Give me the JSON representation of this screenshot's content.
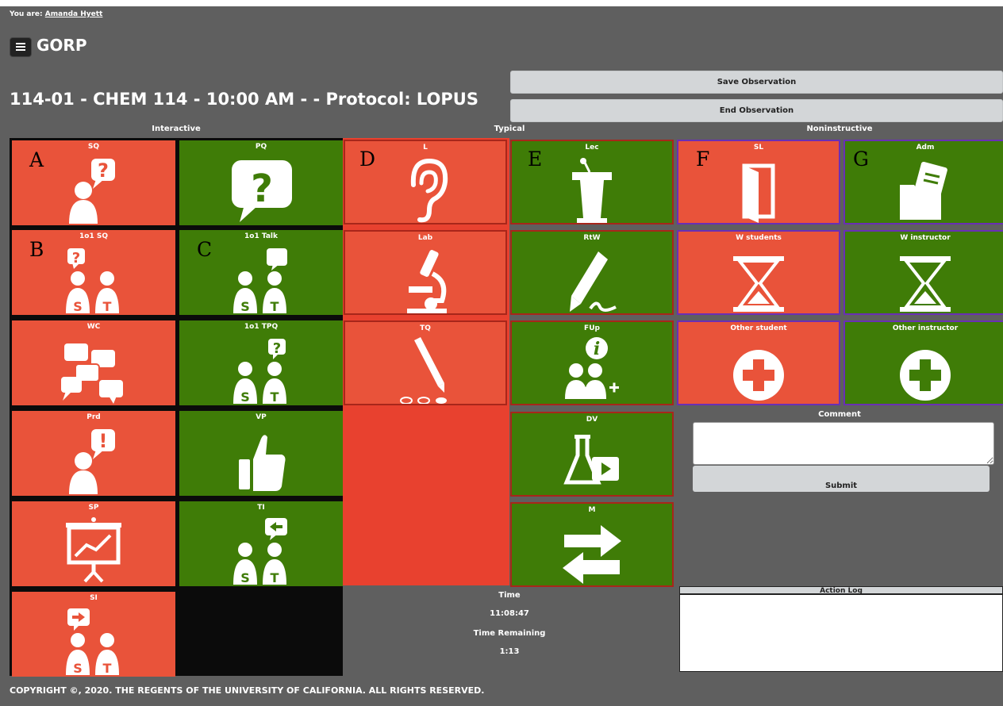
{
  "header": {
    "you_are_label": "You are:",
    "user_name": "Amanda Hyett",
    "app_title": "GORP",
    "course_title": "114-01 - CHEM 114 - 10:00 AM - - Protocol: LOPUS"
  },
  "actions": {
    "save": "Save Observation",
    "end": "End Observation"
  },
  "columns": {
    "interactive": "Interactive",
    "typical": "Typical",
    "noninstructive": "Noninstructive"
  },
  "tiles": {
    "sq": {
      "label": "SQ",
      "letter": "A",
      "icon": "student-question-icon"
    },
    "pq": {
      "label": "PQ",
      "icon": "question-bubble-icon"
    },
    "oosq": {
      "label": "1o1 SQ",
      "letter": "B",
      "icon": "one-on-one-question-icon"
    },
    "ootalk": {
      "label": "1o1 Talk",
      "letter": "C",
      "icon": "one-on-one-talk-icon"
    },
    "wc": {
      "label": "WC",
      "icon": "whole-class-discussion-icon"
    },
    "ootpq": {
      "label": "1o1 TPQ",
      "icon": "one-on-one-teacher-question-icon"
    },
    "prd": {
      "label": "Prd",
      "icon": "prediction-icon"
    },
    "vp": {
      "label": "VP",
      "icon": "thumbs-up-icon"
    },
    "sp": {
      "label": "SP",
      "icon": "presentation-board-icon"
    },
    "ti": {
      "label": "TI",
      "icon": "teacher-initiates-icon"
    },
    "si": {
      "label": "SI",
      "icon": "student-initiates-icon"
    },
    "l": {
      "label": "L",
      "letter": "D",
      "icon": "ear-icon"
    },
    "lec": {
      "label": "Lec",
      "letter": "E",
      "icon": "podium-icon"
    },
    "lab": {
      "label": "Lab",
      "icon": "microscope-icon"
    },
    "rtw": {
      "label": "RtW",
      "icon": "marker-icon"
    },
    "tq": {
      "label": "TQ",
      "icon": "pencil-test-icon"
    },
    "fup": {
      "label": "FUp",
      "icon": "follow-up-icon"
    },
    "dv": {
      "label": "DV",
      "icon": "flask-video-icon"
    },
    "m": {
      "label": "M",
      "icon": "arrows-icon"
    },
    "sl": {
      "label": "SL",
      "letter": "F",
      "icon": "open-door-icon"
    },
    "adm": {
      "label": "Adm",
      "letter": "G",
      "icon": "folder-icon"
    },
    "wstudents": {
      "label": "W students",
      "icon": "hourglass-icon"
    },
    "winstructor": {
      "label": "W instructor",
      "icon": "hourglass-icon"
    },
    "otherstudent": {
      "label": "Other student",
      "icon": "plus-circle-icon"
    },
    "otherinstructor": {
      "label": "Other instructor",
      "icon": "plus-circle-icon"
    }
  },
  "comment": {
    "label": "Comment",
    "value": "",
    "submit": "Submit"
  },
  "timer": {
    "time_label": "Time",
    "time_value": "11:08:47",
    "remaining_label": "Time Remaining",
    "remaining_value": "1:13"
  },
  "log": {
    "label": "Action Log"
  },
  "footer": {
    "copyright": "COPYRIGHT ©, 2020. THE REGENTS OF THE UNIVERSITY OF CALIFORNIA. ALL RIGHTS RESERVED."
  },
  "colors": {
    "red_tile": "#e9533a",
    "green_tile": "#3f7c07",
    "page_bg": "#5f5f5f",
    "button_bg": "#d3d6d8"
  }
}
